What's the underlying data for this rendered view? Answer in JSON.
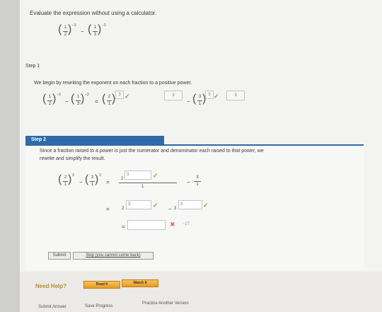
{
  "prompt": {
    "text": "Evaluate the expression without using a calculator."
  },
  "expression": {
    "f1_num": "1",
    "f1_den": "2",
    "f1_exp": "−3",
    "f2_num": "1",
    "f2_den": "3",
    "f2_exp": "−3"
  },
  "step1": {
    "title": "Step 1",
    "text": "We begin by rewriting the exponent on each fraction to a positive power.",
    "answer_a": "3",
    "answer_b": "3",
    "answer_c": "3",
    "answer_d": "3",
    "frac3_num": "2",
    "frac3_den": "1",
    "frac4_num": "3",
    "frac4_den": "1"
  },
  "step2": {
    "title": "Step 2",
    "text_line1": "Since a fraction raised to a power is just the numerator and denominator each raised to that power, we",
    "text_line2": "rewrite and simplify the result.",
    "lhs_f1_num": "2",
    "lhs_f1_den": "1",
    "lhs_exp1": "3",
    "lhs_f2_num": "3",
    "lhs_f2_den": "1",
    "lhs_exp2": "3",
    "num_base1": "2",
    "num_box1": "3",
    "den1": "1",
    "num2": "3",
    "den2": "1",
    "row2_base1": "2",
    "row2_box1": "3",
    "row2_base2": "3",
    "row2_box2": "3",
    "row3_box": "",
    "row3_feedback": "−27",
    "minus": "−",
    "equals": "="
  },
  "buttons": {
    "submit": "Submit",
    "skip": "Skip (you cannot come back)",
    "read_it": "Read It",
    "watch_it": "Watch It",
    "submit_answer": "Submit Answer",
    "save_progress": "Save Progress",
    "practice": "Practice Another Version"
  },
  "help": {
    "label": "Need Help?"
  },
  "colors": {
    "accent_blue": "#2d6aa9",
    "check_green": "#57b83a",
    "cross_red": "#d23b3b",
    "help_orange": "#e89a22"
  }
}
